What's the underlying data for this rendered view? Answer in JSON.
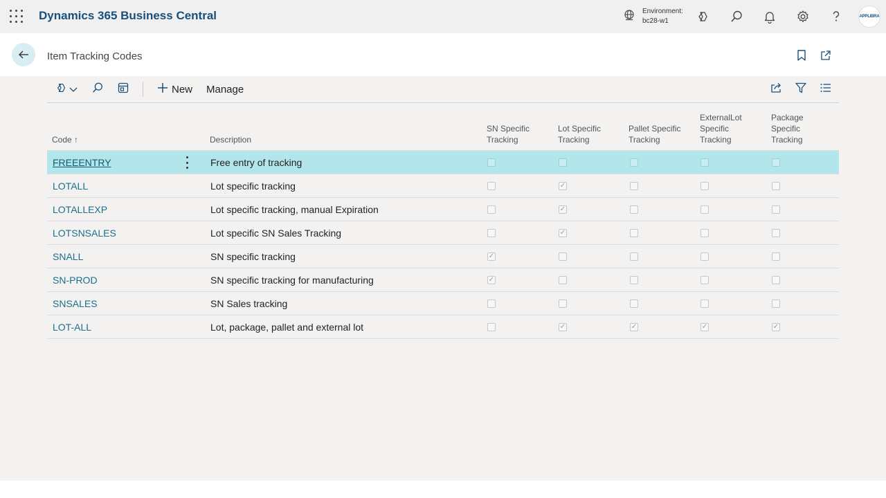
{
  "topbar": {
    "app_title": "Dynamics 365 Business Central",
    "environment_label": "Environment:",
    "environment_value": "bc28-w1",
    "avatar_text": "APPLIBRA"
  },
  "page": {
    "title": "Item Tracking Codes"
  },
  "actionbar": {
    "new_label": "New",
    "manage_label": "Manage"
  },
  "columns": {
    "code": "Code",
    "code_sort_glyph": "↑",
    "description": "Description",
    "sn_specific": [
      "SN Specific",
      "Tracking"
    ],
    "lot_specific": [
      "Lot Specific",
      "Tracking"
    ],
    "pallet_specific": [
      "Pallet Specific",
      "Tracking"
    ],
    "externallot_specific": [
      "ExternalLot",
      "Specific",
      "Tracking"
    ],
    "package_specific": [
      "Package",
      "Specific",
      "Tracking"
    ]
  },
  "rows": [
    {
      "code": "FREEENTRY",
      "description": "Free entry of tracking",
      "sn": false,
      "lot": false,
      "pallet": false,
      "extlot": false,
      "package": false,
      "selected": true
    },
    {
      "code": "LOTALL",
      "description": "Lot specific tracking",
      "sn": false,
      "lot": true,
      "pallet": false,
      "extlot": false,
      "package": false,
      "selected": false
    },
    {
      "code": "LOTALLEXP",
      "description": "Lot specific tracking, manual Expiration",
      "sn": false,
      "lot": true,
      "pallet": false,
      "extlot": false,
      "package": false,
      "selected": false
    },
    {
      "code": "LOTSNSALES",
      "description": "Lot specific SN Sales Tracking",
      "sn": false,
      "lot": true,
      "pallet": false,
      "extlot": false,
      "package": false,
      "selected": false
    },
    {
      "code": "SNALL",
      "description": "SN specific tracking",
      "sn": true,
      "lot": false,
      "pallet": false,
      "extlot": false,
      "package": false,
      "selected": false
    },
    {
      "code": "SN-PROD",
      "description": "SN specific tracking for manufacturing",
      "sn": true,
      "lot": false,
      "pallet": false,
      "extlot": false,
      "package": false,
      "selected": false
    },
    {
      "code": "SNSALES",
      "description": "SN Sales tracking",
      "sn": false,
      "lot": false,
      "pallet": false,
      "extlot": false,
      "package": false,
      "selected": false
    },
    {
      "code": "LOT-ALL",
      "description": "Lot, package, pallet and external lot",
      "sn": false,
      "lot": true,
      "pallet": true,
      "extlot": true,
      "package": true,
      "selected": false
    }
  ],
  "colors": {
    "accent": "#1a4f7a",
    "selected_row": "#b2e6ea",
    "link": "#1a6f8a"
  }
}
